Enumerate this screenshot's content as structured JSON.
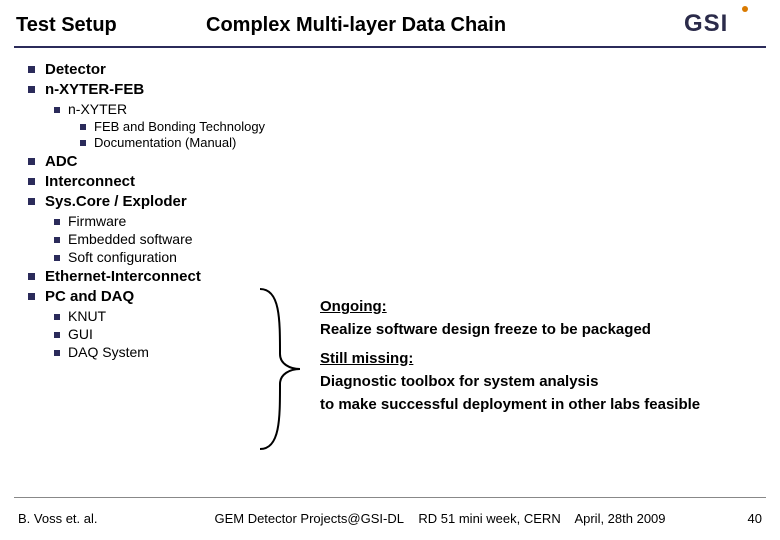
{
  "header": {
    "left": "Test Setup",
    "main": "Complex Multi-layer Data Chain",
    "logo_text": "GSI"
  },
  "outline": {
    "i0": "Detector",
    "i1": "n-XYTER-FEB",
    "i1_0": "n-XYTER",
    "i1_0_0": "FEB and Bonding Technology",
    "i1_0_1": "Documentation (Manual)",
    "i2": "ADC",
    "i3": "Interconnect",
    "i4": "Sys.Core / Exploder",
    "i4_0": "Firmware",
    "i4_1": "Embedded software",
    "i4_2": "Soft configuration",
    "i5": "Ethernet-Interconnect",
    "i6": "PC and DAQ",
    "i6_0": "KNUT",
    "i6_1": "GUI",
    "i6_2": "DAQ System"
  },
  "callout": {
    "h1": "Ongoing:",
    "p1": "Realize software design freeze to be packaged",
    "h2": "Still missing:",
    "p2a": "Diagnostic toolbox for system analysis",
    "p2b": "to make successful deployment in other labs feasible"
  },
  "footer": {
    "author": "B. Voss et. al.",
    "project": "GEM Detector Projects@GSI-DL",
    "event": "RD 51 mini week, CERN",
    "date": "April, 28th 2009",
    "page": "40"
  }
}
